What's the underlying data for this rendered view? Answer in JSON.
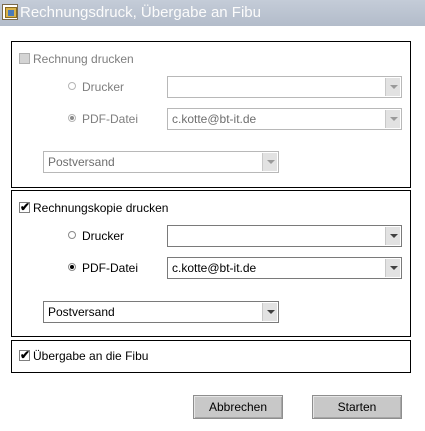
{
  "window": {
    "title": "Rechnungsdruck, Übergabe an Fibu",
    "icon": "app-icon"
  },
  "section_invoice": {
    "checkbox_label": "Rechnung drucken",
    "checked": false,
    "enabled": false,
    "printer_label": "Drucker",
    "printer_selected": false,
    "printer_value": "",
    "pdf_label": "PDF-Datei",
    "pdf_selected": true,
    "pdf_value": "c.kotte@bt-it.de",
    "shipping_value": "Postversand"
  },
  "section_copy": {
    "checkbox_label": "Rechnungskopie drucken",
    "checked": true,
    "enabled": true,
    "printer_label": "Drucker",
    "printer_selected": false,
    "printer_value": "",
    "pdf_label": "PDF-Datei",
    "pdf_selected": true,
    "pdf_value": "c.kotte@bt-it.de",
    "shipping_value": "Postversand"
  },
  "section_fibu": {
    "checkbox_label": "Übergabe an die Fibu",
    "checked": true
  },
  "buttons": {
    "cancel_label": "Abbrechen",
    "start_label": "Starten"
  },
  "colors": {
    "titlebar": "#b9c1ce",
    "disabled_text": "#7e7e7e",
    "button_face": "#c8c8c8"
  }
}
